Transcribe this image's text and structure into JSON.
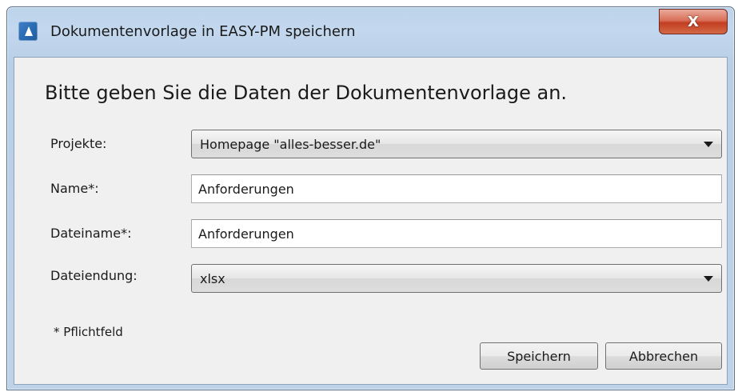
{
  "window": {
    "title": "Dokumentenvorlage in EASY-PM speichern",
    "close_label": "X",
    "app_icon": "easy-pm-app-icon"
  },
  "heading": "Bitte geben Sie die Daten der Dokumentenvorlage an.",
  "form": {
    "projekte": {
      "label": "Projekte:",
      "value": "Homepage \"alles-besser.de\"",
      "icon": "chevron-down-icon"
    },
    "name": {
      "label": "Name*:",
      "value": "Anforderungen"
    },
    "dateiname": {
      "label": "Dateiname*:",
      "value": "Anforderungen"
    },
    "dateiendung": {
      "label": "Dateiendung:",
      "value": "xlsx",
      "icon": "chevron-down-icon"
    }
  },
  "required_note": "* Pflichtfeld",
  "buttons": {
    "save": "Speichern",
    "cancel": "Abbrechen"
  },
  "colors": {
    "frame": "#bfd3e8",
    "client": "#f0f0f0",
    "close_button": "#c9432a"
  }
}
